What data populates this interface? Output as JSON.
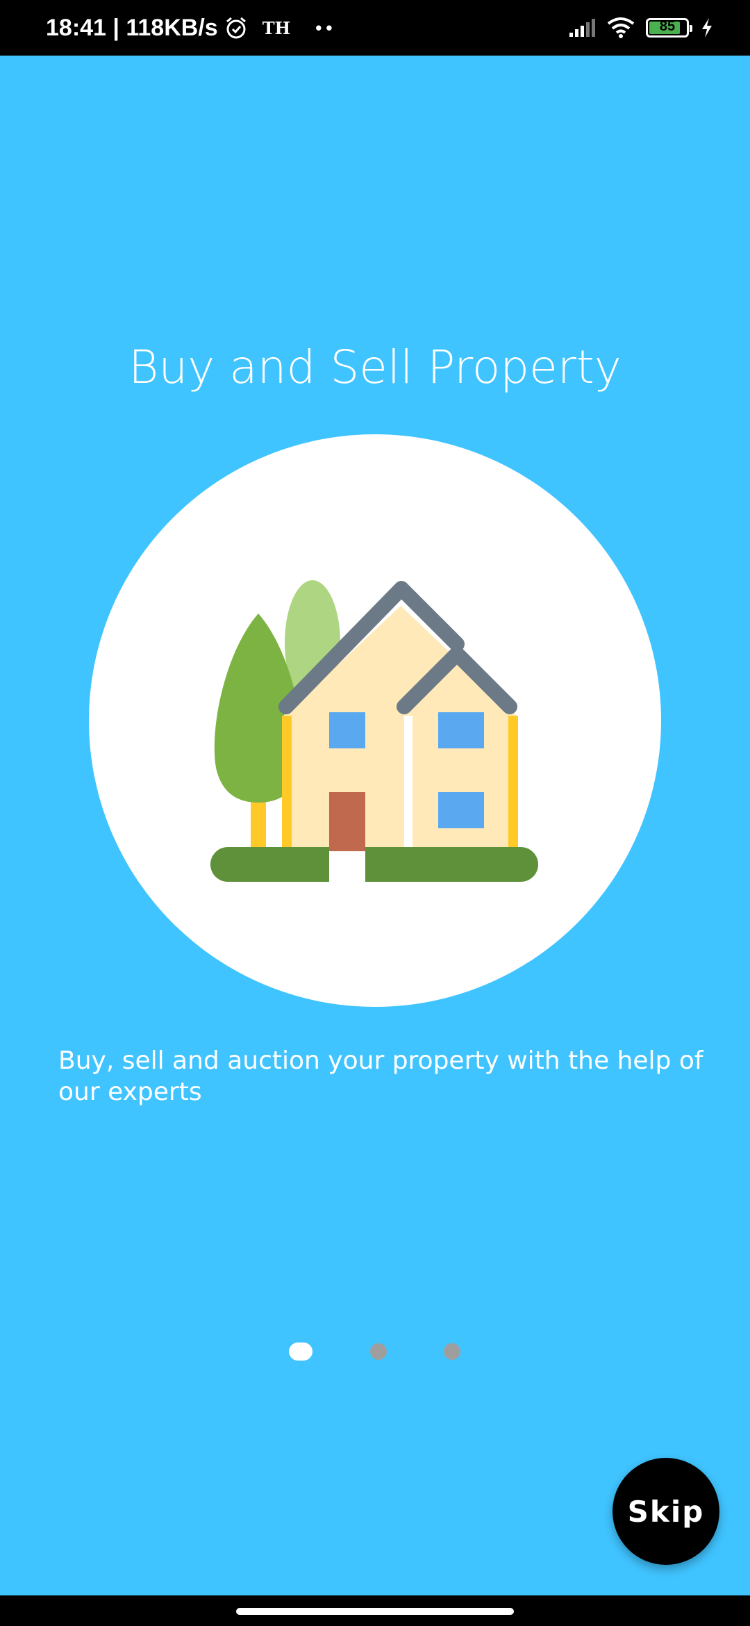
{
  "status_bar": {
    "time_speed": "18:41 | 118KB/s",
    "carrier_label": "TH",
    "dots": "••",
    "battery_level": "85",
    "battery_fraction": 0.85,
    "icons": [
      "alarm-icon",
      "signal-icon",
      "wifi-icon",
      "battery-icon",
      "charging-icon"
    ]
  },
  "onboarding": {
    "title": "Buy and Sell Property",
    "illustration_icon": "house-icon",
    "description": "Buy, sell and auction your property with the help of our experts",
    "pages_total": 3,
    "current_page": 1
  },
  "skip_button": {
    "label": "Skip"
  },
  "colors": {
    "background": "#40C4FF",
    "circle": "#FFFFFF",
    "button": "#000000",
    "dot_active": "#FFFFFF",
    "dot_inactive": "#9E9E9E"
  }
}
